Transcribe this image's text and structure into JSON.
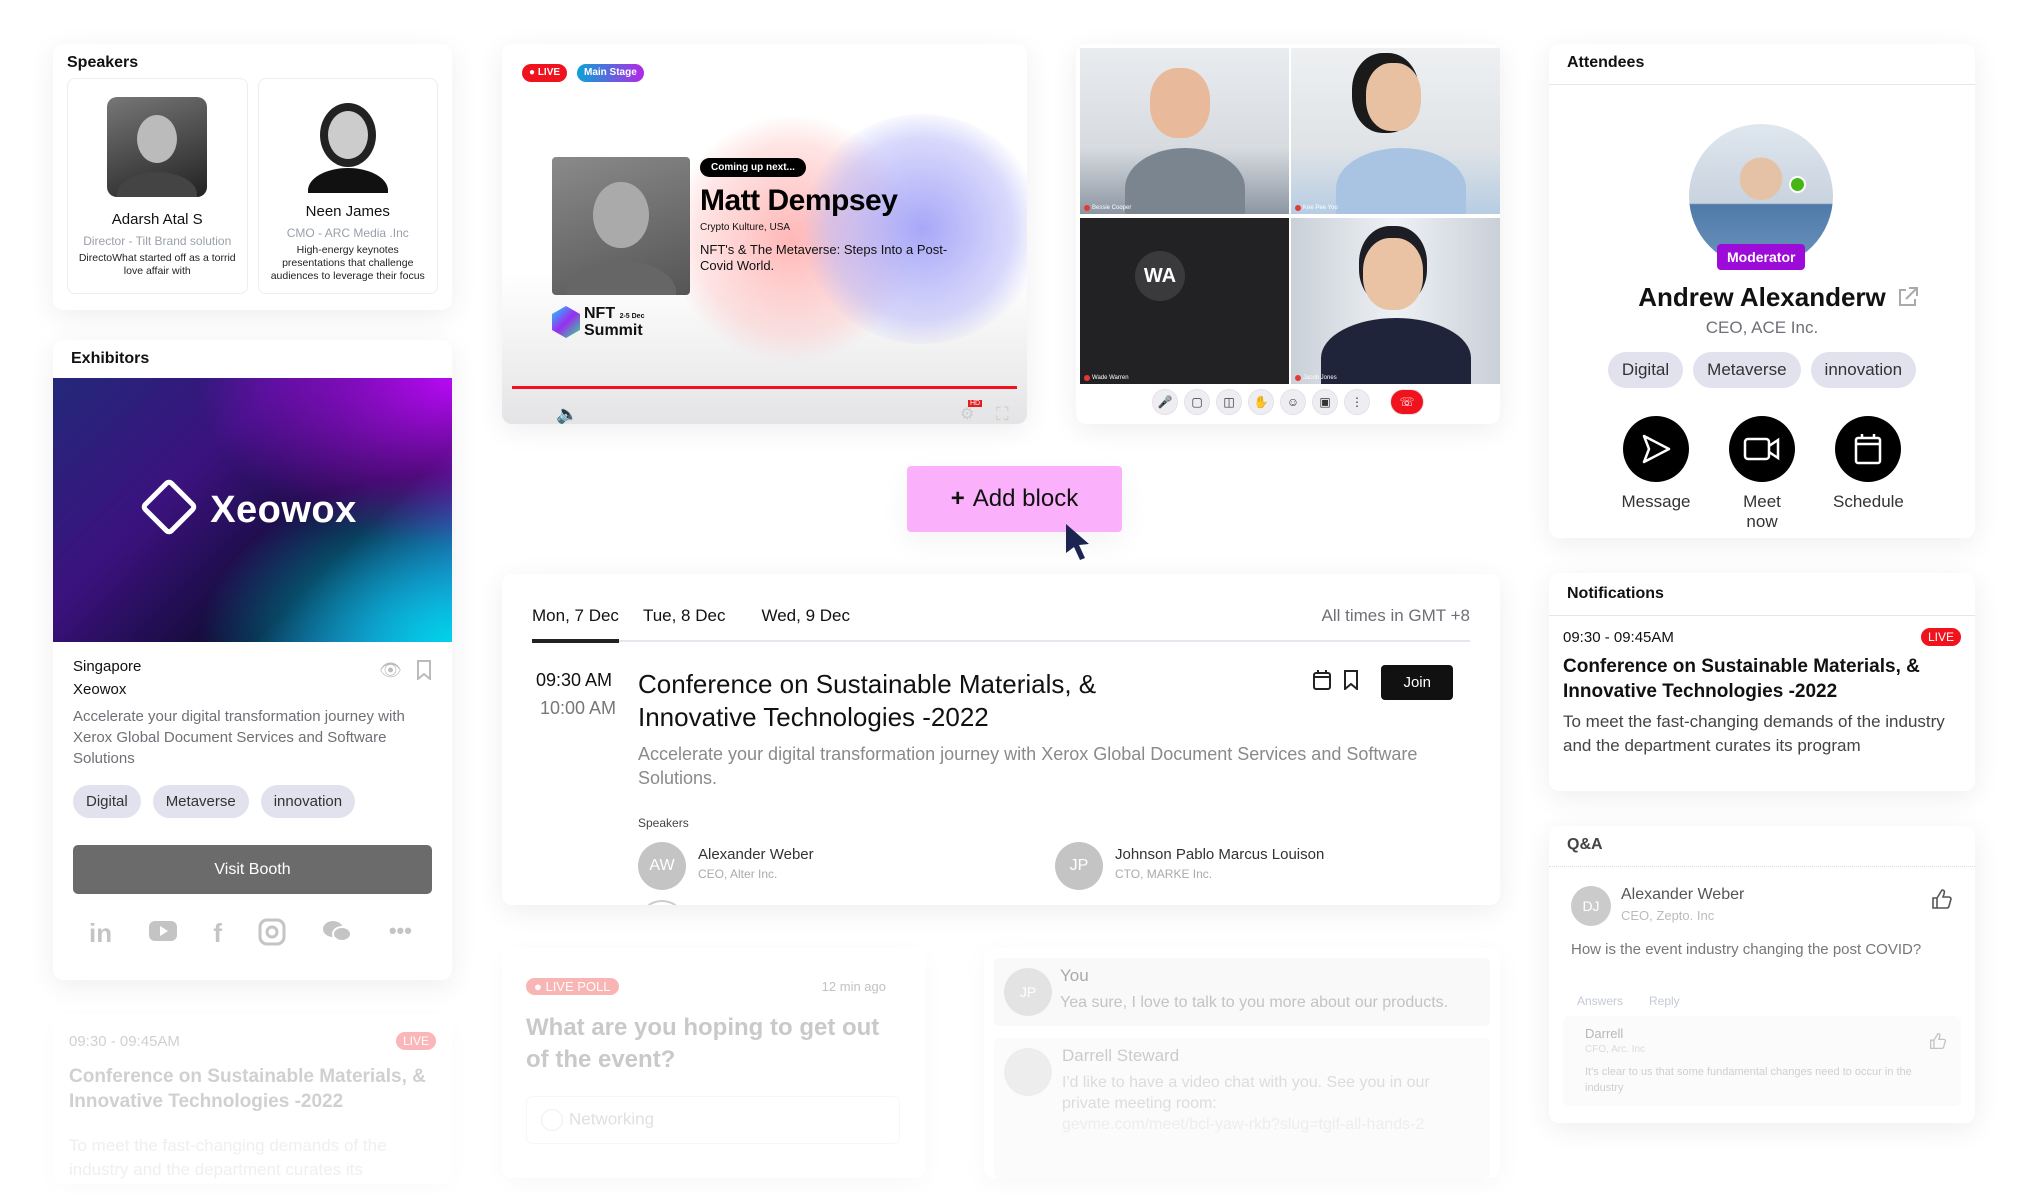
{
  "speakers": {
    "title": "Speakers",
    "items": [
      {
        "name": "Adarsh Atal S",
        "role": "Director - Tilt Brand solution",
        "desc": "DirectoWhat started off as a torrid love affair with"
      },
      {
        "name": "Neen James",
        "role": "CMO - ARC Media .Inc",
        "desc": "High-energy keynotes presentations that challenge audiences to leverage their focus"
      }
    ]
  },
  "exhibitors": {
    "title": "Exhibitors",
    "brand": "Xeowox",
    "location": "Singapore",
    "name": "Xeowox",
    "description": "Accelerate your digital transformation journey with Xerox Global Document Services and Software Solutions",
    "tags": [
      "Digital",
      "Metaverse",
      "innovation"
    ],
    "visit_label": "Visit Booth",
    "socials": [
      "linkedin-icon",
      "youtube-icon",
      "facebook-icon",
      "instagram-icon",
      "wechat-icon",
      "more-icon"
    ]
  },
  "video": {
    "live_label": "LIVE",
    "stage_label": "Main Stage",
    "coming_up": "Coming up next...",
    "speaker_name": "Matt Dempsey",
    "speaker_org": "Crypto Kulture, USA",
    "talk_title": "NFT's & The Metaverse: Steps Into a Post-Covid World.",
    "event_logo_line1": "NFT",
    "event_logo_dates": "2-5 Dec",
    "event_logo_line2": "Summit",
    "hd_label": "HD",
    "progress": 1.0
  },
  "video_call": {
    "participants": [
      {
        "name": "Bessie Cooper"
      },
      {
        "name": "Kee Pee Yoo"
      },
      {
        "name": "Wade Warren",
        "initials": "WA"
      },
      {
        "name": "Jacob Jones"
      }
    ],
    "controls": [
      "mic-icon",
      "camera-icon",
      "share-screen-icon",
      "raise-hand-icon",
      "emoji-icon",
      "fullscreen-icon",
      "more-icon",
      "end-call-icon"
    ]
  },
  "add_block": {
    "label": "Add block"
  },
  "schedule": {
    "tabs": [
      "Mon, 7 Dec",
      "Tue, 8 Dec",
      "Wed, 9 Dec"
    ],
    "active_tab": 0,
    "timezone": "All times in GMT +8",
    "session": {
      "start": "09:30 AM",
      "end": "10:00 AM",
      "title": "Conference on Sustainable Materials, & Innovative Technologies -2022",
      "description": "Accelerate your digital transformation journey with Xerox Global Document Services and Software Solutions.",
      "join_label": "Join",
      "speakers_label": "Speakers",
      "speakers": [
        {
          "initials": "AW",
          "name": "Alexander Weber",
          "role": "CEO, Alter Inc."
        },
        {
          "initials": "JP",
          "name": "Johnson Pablo Marcus Louison",
          "role": "CTO, MARKE Inc."
        }
      ]
    }
  },
  "attendees": {
    "title": "Attendees",
    "badge": "Moderator",
    "name": "Andrew Alexanderw",
    "role": "CEO, ACE Inc.",
    "tags": [
      "Digital",
      "Metaverse",
      "innovation"
    ],
    "actions": [
      "Message",
      "Meet now",
      "Schedule"
    ],
    "status_color": "#46b617"
  },
  "notifications": {
    "title": "Notifications",
    "time": "09:30 - 09:45AM",
    "live": "LIVE",
    "event_title": "Conference on Sustainable Materials, & Innovative Technologies -2022",
    "description": "To meet the fast-changing demands of the industry and the department curates its program"
  },
  "notification_faded": {
    "time": "09:30 - 09:45AM",
    "live": "LIVE",
    "event_title": "Conference on Sustainable Materials, & Innovative Technologies -2022",
    "description": "To meet the fast-changing demands of the industry and the department curates its"
  },
  "poll": {
    "badge": "LIVE POLL",
    "time": "12 min ago",
    "question": "What are you hoping to get out of the event?",
    "options": [
      "Networking"
    ]
  },
  "chat": {
    "messages": [
      {
        "initials": "JP",
        "sender": "You",
        "text": "Yea sure, I love to talk to you more about our products."
      },
      {
        "sender": "Darrell Steward",
        "text": "I'd like to have a video chat with you. See you in our private meeting room:",
        "link": "gevme.com/meet/bcl-yaw-rkb?slug=tgif-all-hands-2"
      }
    ]
  },
  "qa": {
    "title": "Q&A",
    "question": {
      "initials": "DJ",
      "name": "Alexander Weber",
      "role": "CEO, Zepto. Inc",
      "text": "How is the event industry changing the post COVID?"
    },
    "answers_label": "Answers",
    "reply_label": "Reply",
    "answer": {
      "name": "Darrell",
      "role": "CFO, Arc. Inc",
      "text": "It's clear to us that some fundamental changes need to occur in the industry"
    }
  },
  "colors": {
    "accent_pink": "#fbb0fb",
    "live_red": "#f0131e",
    "moderator_purple": "#9c0bd7",
    "tag_bg": "#e1e2ee"
  }
}
